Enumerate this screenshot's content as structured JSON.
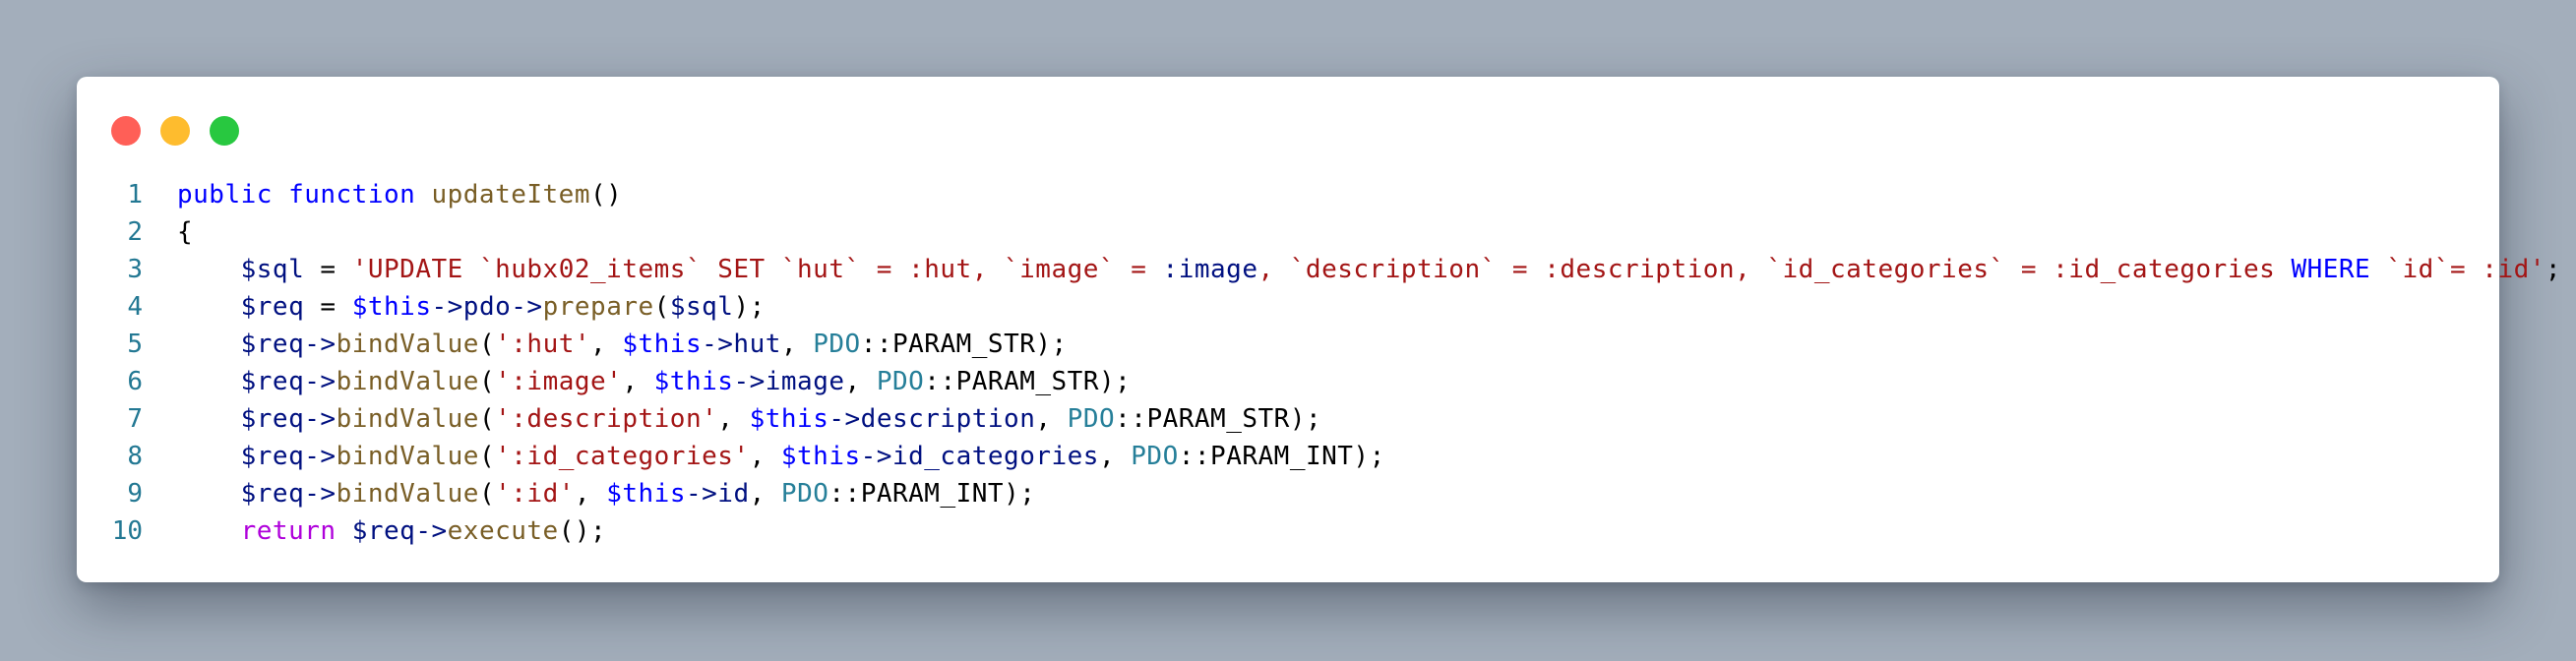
{
  "window": {
    "controls": [
      {
        "name": "close",
        "color": "#ff5f57"
      },
      {
        "name": "minimize",
        "color": "#febc2e"
      },
      {
        "name": "zoom",
        "color": "#28c840"
      }
    ]
  },
  "theme": {
    "background": "#a3aebb",
    "window_bg": "#ffffff",
    "line_number_color": "#237893",
    "keyword_color": "#0000ff",
    "function_color": "#795e26",
    "variable_color": "#001080",
    "string_color": "#a31515",
    "class_color": "#267f99",
    "control_color": "#af00db"
  },
  "code": {
    "lines": [
      {
        "n": "1",
        "tokens": [
          {
            "t": "public function ",
            "k": "kw"
          },
          {
            "t": "updateItem",
            "k": "fn"
          },
          {
            "t": "()",
            "k": "plain"
          }
        ]
      },
      {
        "n": "2",
        "tokens": [
          {
            "t": "{",
            "k": "plain"
          }
        ]
      },
      {
        "n": "3",
        "tokens": [
          {
            "t": "    ",
            "k": "plain"
          },
          {
            "t": "$sql",
            "k": "var"
          },
          {
            "t": " = ",
            "k": "plain"
          },
          {
            "t": "'UPDATE `hubx02_items` SET `hut` = :hut, `image` = ",
            "k": "str"
          },
          {
            "t": ":image",
            "k": "var"
          },
          {
            "t": ", `description` = :description, `id_categories` = :id_categories ",
            "k": "str"
          },
          {
            "t": "WHERE",
            "k": "kw"
          },
          {
            "t": " `id`= :id'",
            "k": "str"
          },
          {
            "t": ";",
            "k": "plain"
          }
        ]
      },
      {
        "n": "4",
        "tokens": [
          {
            "t": "    ",
            "k": "plain"
          },
          {
            "t": "$req",
            "k": "var"
          },
          {
            "t": " = ",
            "k": "plain"
          },
          {
            "t": "$this",
            "k": "this"
          },
          {
            "t": "->pdo->",
            "k": "var"
          },
          {
            "t": "prepare",
            "k": "fn"
          },
          {
            "t": "(",
            "k": "plain"
          },
          {
            "t": "$sql",
            "k": "var"
          },
          {
            "t": ");",
            "k": "plain"
          }
        ]
      },
      {
        "n": "5",
        "tokens": [
          {
            "t": "    ",
            "k": "plain"
          },
          {
            "t": "$req",
            "k": "var"
          },
          {
            "t": "->",
            "k": "var"
          },
          {
            "t": "bindValue",
            "k": "fn"
          },
          {
            "t": "(",
            "k": "plain"
          },
          {
            "t": "':hut'",
            "k": "str"
          },
          {
            "t": ", ",
            "k": "plain"
          },
          {
            "t": "$this",
            "k": "this"
          },
          {
            "t": "->hut",
            "k": "var"
          },
          {
            "t": ", ",
            "k": "plain"
          },
          {
            "t": "PDO",
            "k": "cls"
          },
          {
            "t": "::PARAM_STR);",
            "k": "plain"
          }
        ]
      },
      {
        "n": "6",
        "tokens": [
          {
            "t": "    ",
            "k": "plain"
          },
          {
            "t": "$req",
            "k": "var"
          },
          {
            "t": "->",
            "k": "var"
          },
          {
            "t": "bindValue",
            "k": "fn"
          },
          {
            "t": "(",
            "k": "plain"
          },
          {
            "t": "':image'",
            "k": "str"
          },
          {
            "t": ", ",
            "k": "plain"
          },
          {
            "t": "$this",
            "k": "this"
          },
          {
            "t": "->image",
            "k": "var"
          },
          {
            "t": ", ",
            "k": "plain"
          },
          {
            "t": "PDO",
            "k": "cls"
          },
          {
            "t": "::PARAM_STR);",
            "k": "plain"
          }
        ]
      },
      {
        "n": "7",
        "tokens": [
          {
            "t": "    ",
            "k": "plain"
          },
          {
            "t": "$req",
            "k": "var"
          },
          {
            "t": "->",
            "k": "var"
          },
          {
            "t": "bindValue",
            "k": "fn"
          },
          {
            "t": "(",
            "k": "plain"
          },
          {
            "t": "':description'",
            "k": "str"
          },
          {
            "t": ", ",
            "k": "plain"
          },
          {
            "t": "$this",
            "k": "this"
          },
          {
            "t": "->description",
            "k": "var"
          },
          {
            "t": ", ",
            "k": "plain"
          },
          {
            "t": "PDO",
            "k": "cls"
          },
          {
            "t": "::PARAM_STR);",
            "k": "plain"
          }
        ]
      },
      {
        "n": "8",
        "tokens": [
          {
            "t": "    ",
            "k": "plain"
          },
          {
            "t": "$req",
            "k": "var"
          },
          {
            "t": "->",
            "k": "var"
          },
          {
            "t": "bindValue",
            "k": "fn"
          },
          {
            "t": "(",
            "k": "plain"
          },
          {
            "t": "':id_categories'",
            "k": "str"
          },
          {
            "t": ", ",
            "k": "plain"
          },
          {
            "t": "$this",
            "k": "this"
          },
          {
            "t": "->id_categories",
            "k": "var"
          },
          {
            "t": ", ",
            "k": "plain"
          },
          {
            "t": "PDO",
            "k": "cls"
          },
          {
            "t": "::PARAM_INT);",
            "k": "plain"
          }
        ]
      },
      {
        "n": "9",
        "tokens": [
          {
            "t": "    ",
            "k": "plain"
          },
          {
            "t": "$req",
            "k": "var"
          },
          {
            "t": "->",
            "k": "var"
          },
          {
            "t": "bindValue",
            "k": "fn"
          },
          {
            "t": "(",
            "k": "plain"
          },
          {
            "t": "':id'",
            "k": "str"
          },
          {
            "t": ", ",
            "k": "plain"
          },
          {
            "t": "$this",
            "k": "this"
          },
          {
            "t": "->id",
            "k": "var"
          },
          {
            "t": ", ",
            "k": "plain"
          },
          {
            "t": "PDO",
            "k": "cls"
          },
          {
            "t": "::PARAM_INT);",
            "k": "plain"
          }
        ]
      },
      {
        "n": "10",
        "tokens": [
          {
            "t": "    ",
            "k": "plain"
          },
          {
            "t": "return",
            "k": "ctl"
          },
          {
            "t": " ",
            "k": "plain"
          },
          {
            "t": "$req",
            "k": "var"
          },
          {
            "t": "->",
            "k": "var"
          },
          {
            "t": "execute",
            "k": "fn"
          },
          {
            "t": "();",
            "k": "plain"
          }
        ]
      }
    ]
  }
}
